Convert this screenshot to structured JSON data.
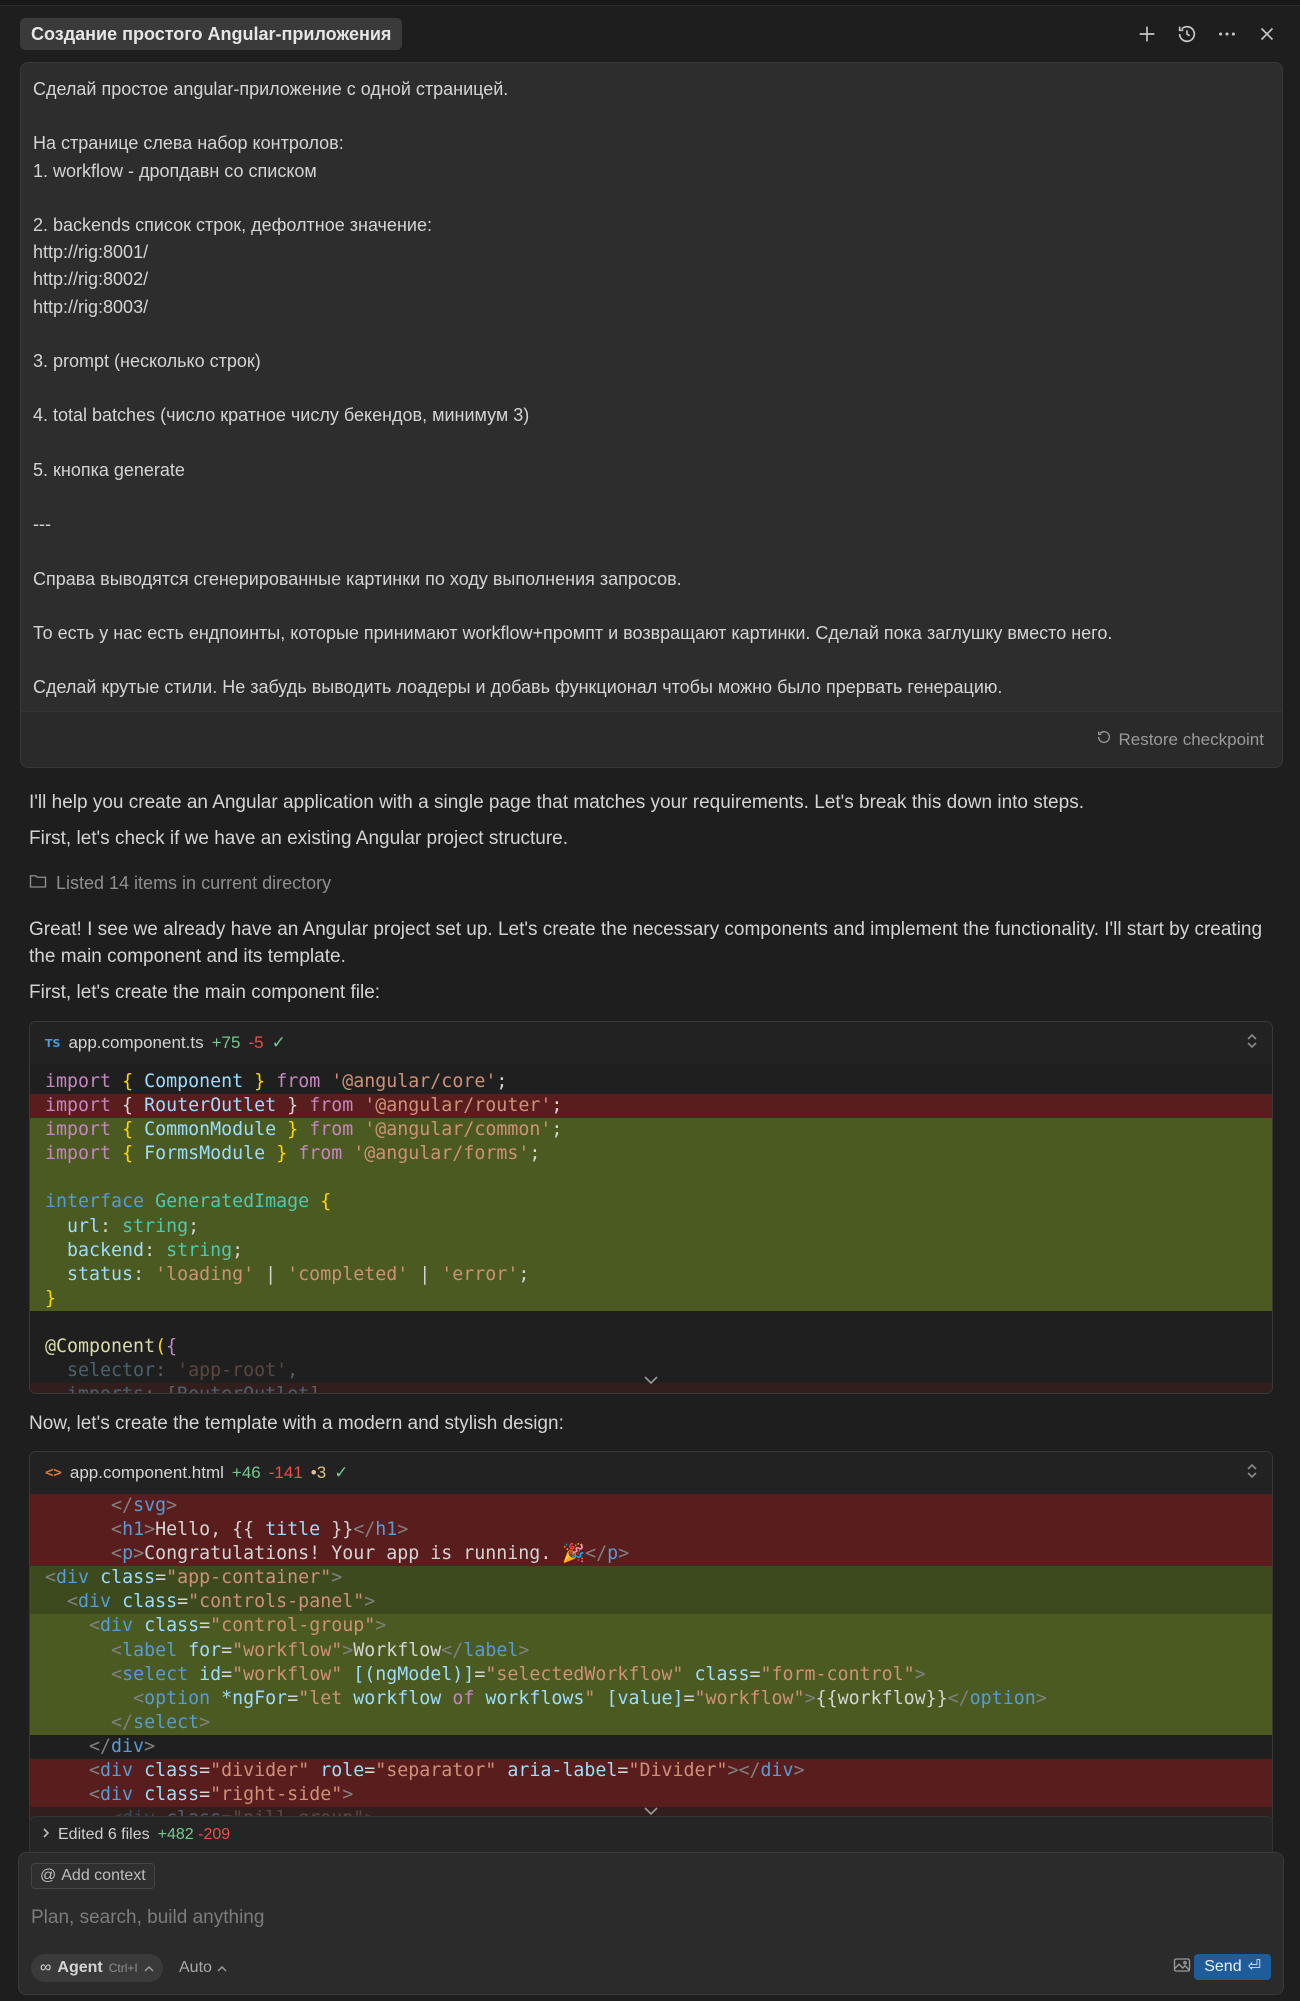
{
  "header": {
    "title": "Создание простого Angular-приложения",
    "icons": [
      "plus-icon",
      "history-icon",
      "more-icon",
      "close-icon"
    ]
  },
  "prompt": {
    "lines": [
      "Сделай простое angular-приложение с одной страницей.",
      "",
      "На странице слева набор контролов:",
      "1. workflow - дропдавн со списком",
      "",
      "2. backends список строк, дефолтное значение:",
      "http://rig:8001/",
      "http://rig:8002/",
      "http://rig:8003/",
      "",
      "3. prompt (несколько строк)",
      "",
      "4. total batches (число кратное числу бекендов, минимум 3)",
      "",
      "5. кнопка generate",
      "",
      "---",
      "",
      "Справа выводятся сгенерированные картинки по ходу выполнения запросов.",
      "",
      "То есть у нас есть ендпоинты, которые принимают workflow+промпт и возвращают картинки. Сделай пока заглушку вместо него.",
      "",
      "Сделай крутые стили. Не забудь выводить лоадеры и добавь функционал чтобы можно было прервать генерацию."
    ],
    "restore_label": "Restore checkpoint"
  },
  "assistant": {
    "p1": "I'll help you create an Angular application with a single page that matches your requirements. Let's break this down into steps.",
    "p2": "First, let's check if we have an existing Angular project structure.",
    "tool": "Listed 14 items in current directory",
    "p3": "Great! I see we already have an Angular project set up. Let's create the necessary components and implement the functionality. I'll start by creating the main component and its template.",
    "p4": "First, let's create the main component file:",
    "p5": "Now, let's create the template with a modern and stylish design:"
  },
  "code1": {
    "badge": "TS",
    "filename": "app.component.ts",
    "added": "+75",
    "removed": "-5"
  },
  "code2": {
    "badge": "<>",
    "filename": "app.component.html",
    "added": "+46",
    "removed": "-141",
    "modified": "•3"
  },
  "edited": {
    "label": "Edited 6 files",
    "added": "+482",
    "removed": "-209"
  },
  "composer": {
    "add_context": "Add context",
    "placeholder": "Plan, search, build anything",
    "agent_label": "Agent",
    "agent_shortcut": "Ctrl+I",
    "model_label": "Auto",
    "send_label": "Send"
  }
}
